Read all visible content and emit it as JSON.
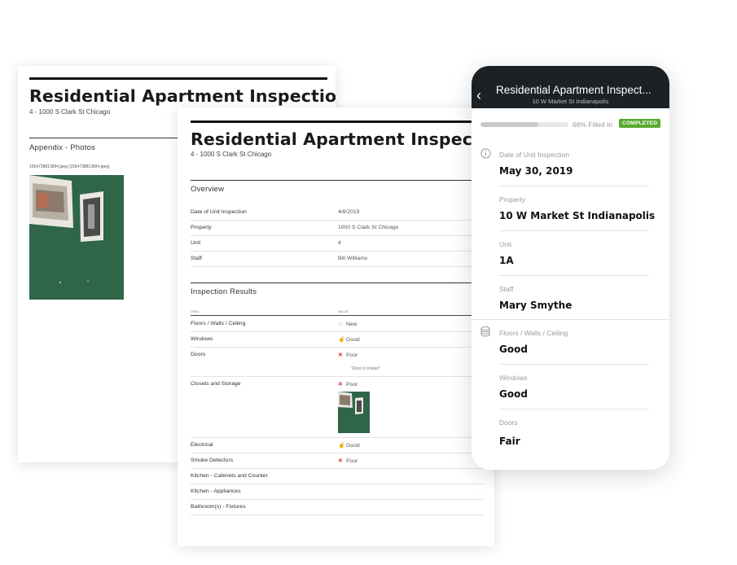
{
  "back_doc": {
    "title": "Residential Apartment Inspection",
    "address": "4 - 1000 S Clark St Chicago",
    "appendix_heading": "Appendix - Photos",
    "photo_caption": "1554738813894.jpeg (1554738813894.jpeg)"
  },
  "front_doc": {
    "title": "Residential Apartment Inspection",
    "address": "4 - 1000 S Clark St Chicago",
    "overview_heading": "Overview",
    "overview_rows": [
      {
        "label": "Date of Unit Inspection",
        "value": "4/8/2019"
      },
      {
        "label": "Property",
        "value": "1000 S Clark St Chicago"
      },
      {
        "label": "Unit",
        "value": "4"
      },
      {
        "label": "Staff",
        "value": "Bill Williams"
      }
    ],
    "results_heading": "Inspection Results",
    "col_item": "ITEM",
    "col_value": "VALUE",
    "results": [
      {
        "item": "Floors / Walls / Ceiling",
        "value": "New",
        "icon": "star-icon"
      },
      {
        "item": "Windows",
        "value": "Good",
        "icon": "thumbs-up-icon"
      },
      {
        "item": "Doors",
        "value": "Poor",
        "icon": "cross-icon",
        "note": "\"Door is broken\""
      },
      {
        "item": "Closets and Storage",
        "value": "Poor",
        "icon": "cross-icon"
      },
      {
        "item": "Electrical",
        "value": "Good",
        "icon": "thumbs-up-icon"
      },
      {
        "item": "Smoke Detectors",
        "value": "Poor",
        "icon": "cross-icon"
      },
      {
        "item": "Kitchen - Cabinets and Counter",
        "value": ""
      },
      {
        "item": "Kitchen - Appliances",
        "value": ""
      },
      {
        "item": "Bathroom(s) - Fixtures",
        "value": ""
      }
    ]
  },
  "mobile": {
    "title": "Residential Apartment Inspect...",
    "subtitle": "10 W Market St Indianapolis",
    "progress": 0.66,
    "progress_text": "66% Filled In",
    "status": "COMPLETED",
    "fields": [
      {
        "label": "Date of Unit Inspection",
        "value": "May 30, 2019",
        "icon": "info-icon"
      },
      {
        "label": "Property",
        "value": "10 W Market St Indianapolis"
      },
      {
        "label": "Unit",
        "value": "1A"
      },
      {
        "label": "Staff",
        "value": "Mary Smythe"
      },
      {
        "label": "Floors / Walls / Ceiling",
        "value": "Good",
        "icon": "database-icon"
      },
      {
        "label": "Windows",
        "value": "Good"
      },
      {
        "label": "Doors",
        "value": "Fair"
      }
    ]
  },
  "colors": {
    "status_green": "#5aaa32",
    "header_dark": "#1c2126",
    "wall_green": "#2e6447"
  }
}
